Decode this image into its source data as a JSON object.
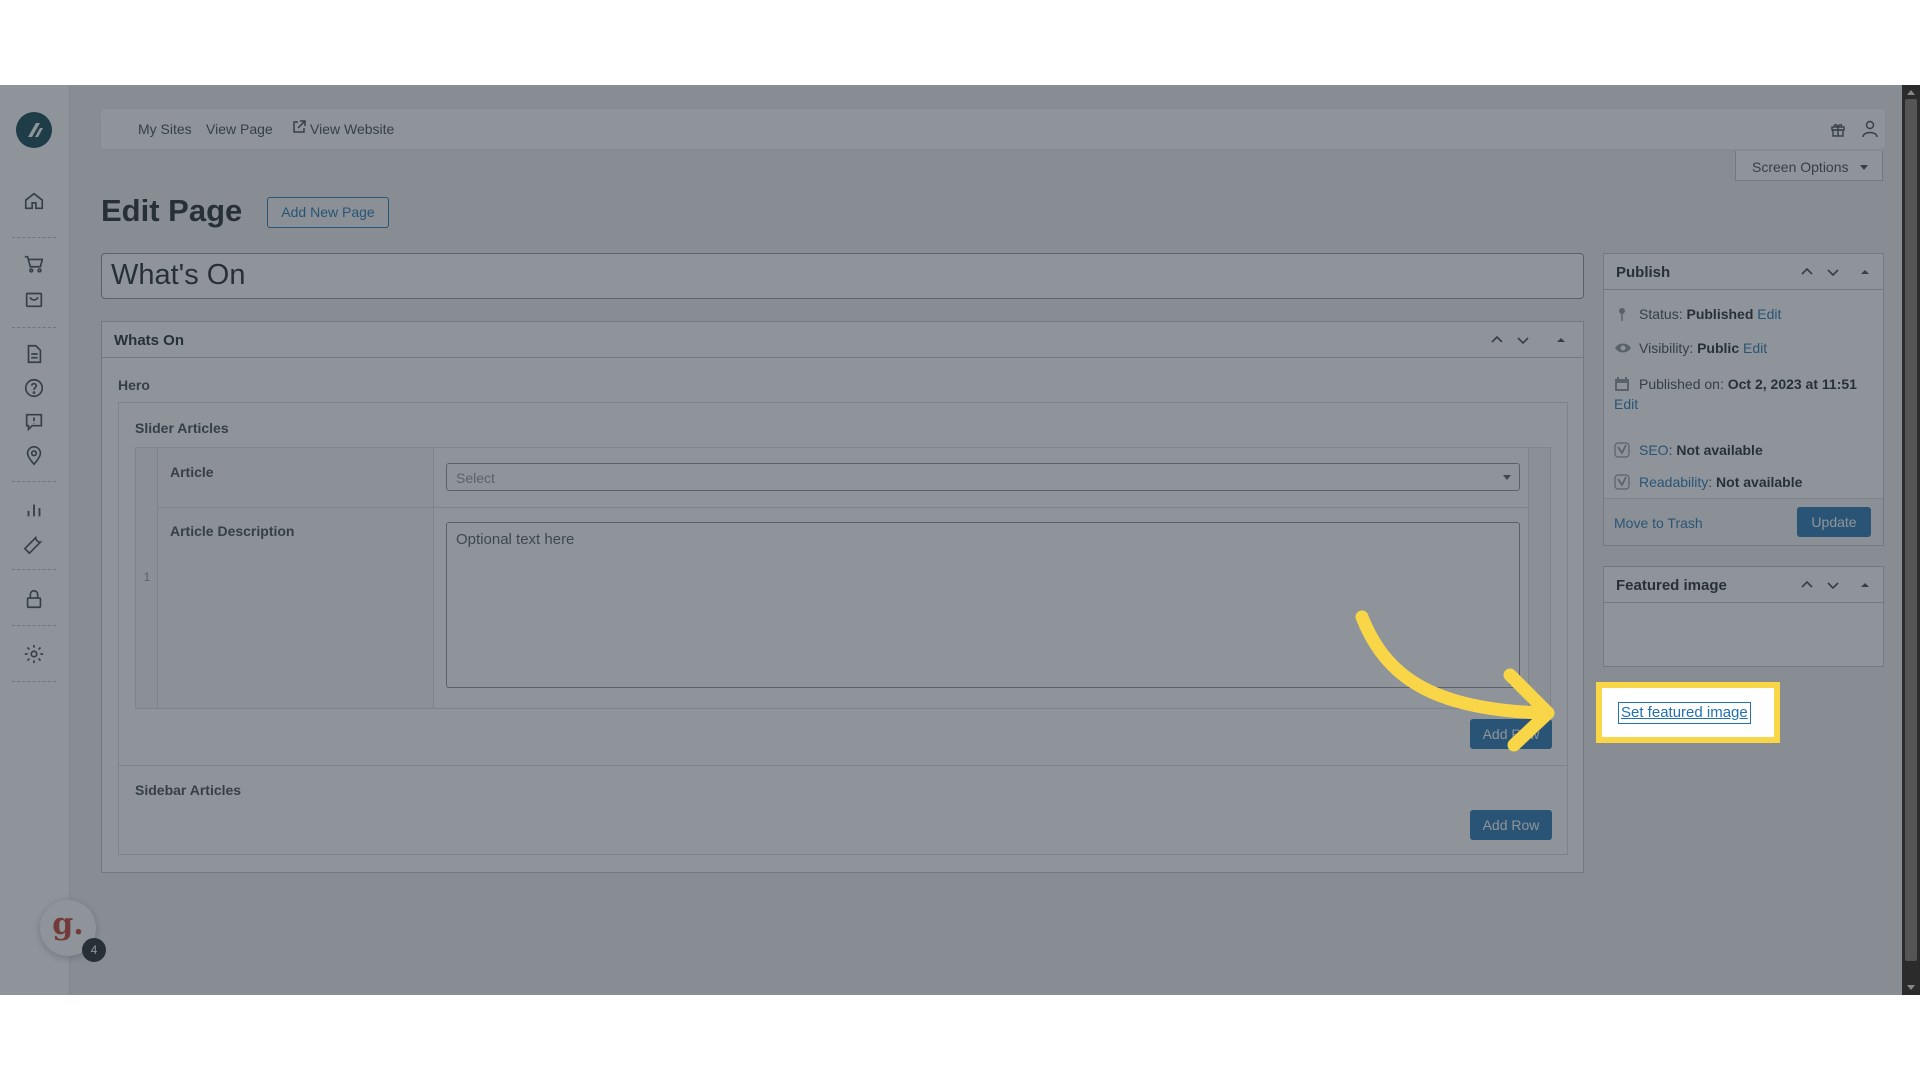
{
  "topbar": {
    "my_sites": "My Sites",
    "view_page": "View Page",
    "view_website": "View Website"
  },
  "screen_options": "Screen Options",
  "page": {
    "title": "Edit Page",
    "add_new": "Add New Page"
  },
  "post_title": "What's On",
  "whats_on": {
    "title": "Whats On",
    "hero": "Hero",
    "slider_articles": "Slider Articles",
    "row_index": "1",
    "article_label": "Article",
    "article_placeholder": "Select",
    "description_label": "Article Description",
    "description_placeholder": "Optional text here",
    "add_row": "Add Row",
    "sidebar_articles": "Sidebar Articles",
    "add_row_2": "Add Row"
  },
  "publish": {
    "title": "Publish",
    "status_label": "Status:",
    "status_value": "Published",
    "visibility_label": "Visibility:",
    "visibility_value": "Public",
    "published_label": "Published on:",
    "published_value": "Oct 2, 2023 at 11:51",
    "edit": "Edit",
    "seo_link": "SEO",
    "seo_value": "Not available",
    "readability_link": "Readability",
    "readability_value": "Not available",
    "trash": "Move to Trash",
    "update": "Update"
  },
  "featured": {
    "title": "Featured image",
    "set_link": "Set featured image"
  },
  "avatar": {
    "letter": "g.",
    "badge": "4"
  },
  "colors": {
    "accent": "#2271b1",
    "highlight": "#f9d648",
    "overlay": "#323c46"
  },
  "icons": [
    "home-icon",
    "cart-icon",
    "bag-icon",
    "page-icon",
    "help-icon",
    "comment-icon",
    "location-icon",
    "chart-icon",
    "wrench-icon",
    "lock-icon",
    "gear-icon",
    "gift-icon",
    "user-icon",
    "external-link-icon"
  ]
}
